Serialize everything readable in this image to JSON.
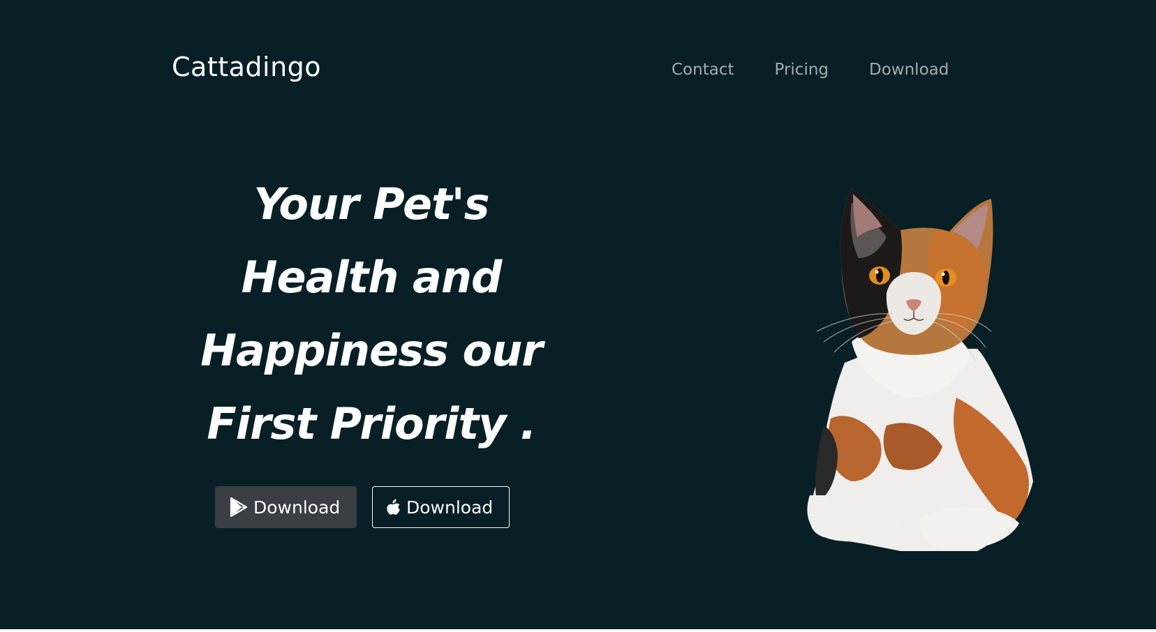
{
  "header": {
    "brand": "Cattadingo",
    "nav": [
      "Contact",
      "Pricing",
      "Download"
    ]
  },
  "hero": {
    "headline_lines": [
      "Your Pet's",
      "Health and",
      "Happiness our",
      "First Priority ."
    ],
    "buttons": [
      {
        "label": "Download",
        "icon": "google-play-icon"
      },
      {
        "label": "Download",
        "icon": "apple-icon"
      }
    ],
    "image": "calico-cat-image"
  },
  "colors": {
    "background": "#081f26",
    "nav_text": "#a5acae",
    "play_button_bg": "#3a3f44",
    "text": "#ffffff"
  }
}
